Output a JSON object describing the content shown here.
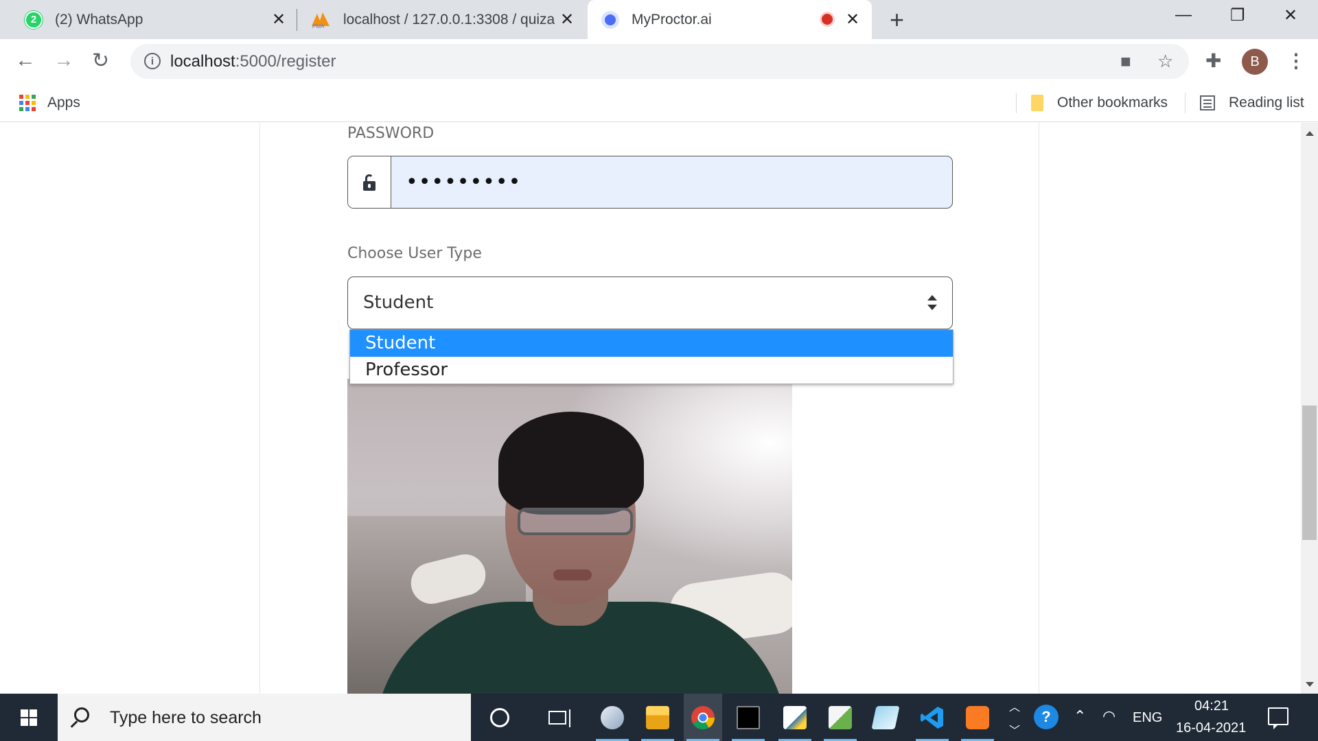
{
  "browser": {
    "tabs": [
      {
        "title": "(2) WhatsApp",
        "badge": "2",
        "active": false
      },
      {
        "title": "localhost / 127.0.0.1:3308 / quiza",
        "active": false
      },
      {
        "title": "MyProctor.ai",
        "active": true,
        "recording": true
      }
    ],
    "new_tab": "+",
    "url_host": "localhost",
    "url_path": ":5000/register",
    "profile_initial": "B",
    "bookmarks": {
      "apps": "Apps",
      "other": "Other bookmarks",
      "reading_list": "Reading list"
    }
  },
  "form": {
    "password_label": "PASSWORD",
    "password_value": "•••••••••",
    "user_type_label": "Choose User Type",
    "user_type_selected": "Student",
    "user_type_options": [
      "Student",
      "Professor"
    ]
  },
  "taskbar": {
    "search_placeholder": "Type here to search",
    "language": "ENG",
    "time": "04:21",
    "date": "16-04-2021"
  },
  "colors": {
    "option_highlight": "#1e90ff",
    "autofill_bg": "#e8f0fe",
    "taskbar_bg": "#1f2a36"
  }
}
